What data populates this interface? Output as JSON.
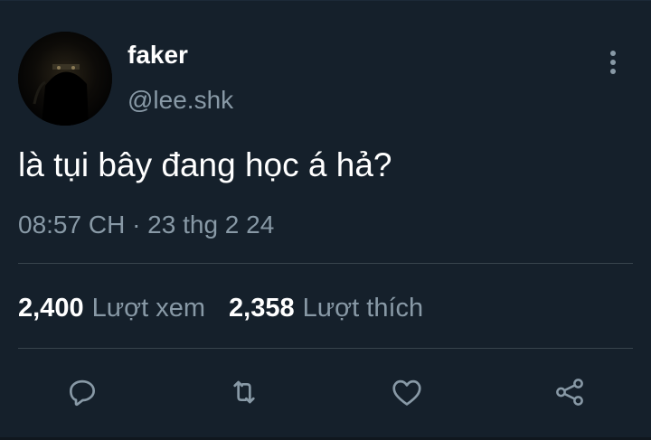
{
  "author": {
    "display_name": "faker",
    "handle": "@lee.shk"
  },
  "tweet": {
    "text": "là tụi bây đang học á hả?",
    "timestamp": "08:57 CH · 23 thg 2 24"
  },
  "stats": {
    "views_count": "2,400",
    "views_label": "Lượt xem",
    "likes_count": "2,358",
    "likes_label": "Lượt thích"
  },
  "actions": {
    "icons": [
      "reply-icon",
      "retweet-icon",
      "like-icon",
      "share-icon"
    ]
  },
  "colors": {
    "background": "#15202b",
    "primary_text": "#ffffff",
    "secondary_text": "#8899a6",
    "divider": "#38444d"
  }
}
